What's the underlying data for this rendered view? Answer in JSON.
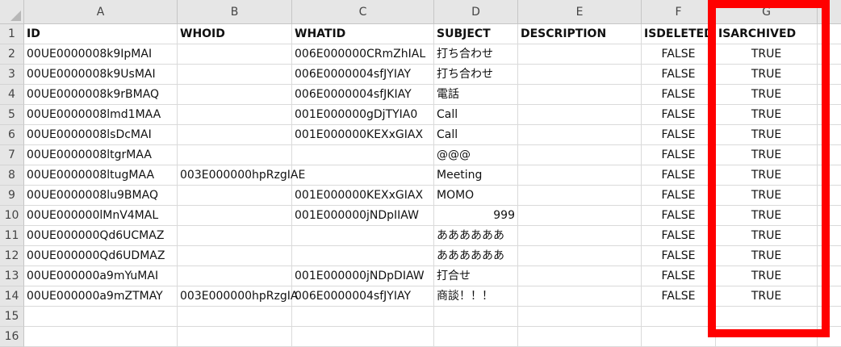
{
  "columns": [
    "A",
    "B",
    "C",
    "D",
    "E",
    "F",
    "G"
  ],
  "row_numbers": [
    "1",
    "2",
    "3",
    "4",
    "5",
    "6",
    "7",
    "8",
    "9",
    "10",
    "11",
    "12",
    "13",
    "14",
    "15",
    "16"
  ],
  "rows": [
    [
      "ID",
      "WHOID",
      "WHATID",
      "SUBJECT",
      "DESCRIPTION",
      "ISDELETED",
      "ISARCHIVED"
    ],
    [
      "00UE0000008k9IpMAI",
      "",
      "006E000000CRmZhIAL",
      "打ち合わせ",
      "",
      "FALSE",
      "TRUE"
    ],
    [
      "00UE0000008k9UsMAI",
      "",
      "006E0000004sfJYIAY",
      "打ち合わせ",
      "",
      "FALSE",
      "TRUE"
    ],
    [
      "00UE0000008k9rBMAQ",
      "",
      "006E0000004sfJKIAY",
      "電話",
      "",
      "FALSE",
      "TRUE"
    ],
    [
      "00UE0000008lmd1MAA",
      "",
      "001E000000gDjTYIA0",
      "Call",
      "",
      "FALSE",
      "TRUE"
    ],
    [
      "00UE0000008lsDcMAI",
      "",
      "001E000000KEXxGIAX",
      "Call",
      "",
      "FALSE",
      "TRUE"
    ],
    [
      "00UE0000008ltgrMAA",
      "",
      "",
      "@@@",
      "",
      "FALSE",
      "TRUE"
    ],
    [
      "00UE0000008ltugMAA",
      "003E000000hpRzgIAE",
      "",
      "Meeting",
      "",
      "FALSE",
      "TRUE"
    ],
    [
      "00UE0000008lu9BMAQ",
      "",
      "001E000000KEXxGIAX",
      "MOMO",
      "",
      "FALSE",
      "TRUE"
    ],
    [
      "00UE000000lMnV4MAL",
      "",
      "001E000000jNDpIIAW",
      "999",
      "",
      "FALSE",
      "TRUE"
    ],
    [
      "00UE000000Qd6UCMAZ",
      "",
      "",
      "ああああああ",
      "",
      "FALSE",
      "TRUE"
    ],
    [
      "00UE000000Qd6UDMAZ",
      "",
      "",
      "ああああああ",
      "",
      "FALSE",
      "TRUE"
    ],
    [
      "00UE000000a9mYuMAI",
      "",
      "001E000000jNDpDIAW",
      "打合せ",
      "",
      "FALSE",
      "TRUE"
    ],
    [
      "00UE000000a9mZTMAY",
      "003E000000hpRzgIA",
      "006E0000004sfJYIAY",
      "商談！！！",
      "",
      "FALSE",
      "TRUE"
    ],
    [
      "",
      "",
      "",
      "",
      "",
      "",
      ""
    ],
    [
      "",
      "",
      "",
      "",
      "",
      "",
      ""
    ]
  ],
  "highlight_color": "#ff0000"
}
